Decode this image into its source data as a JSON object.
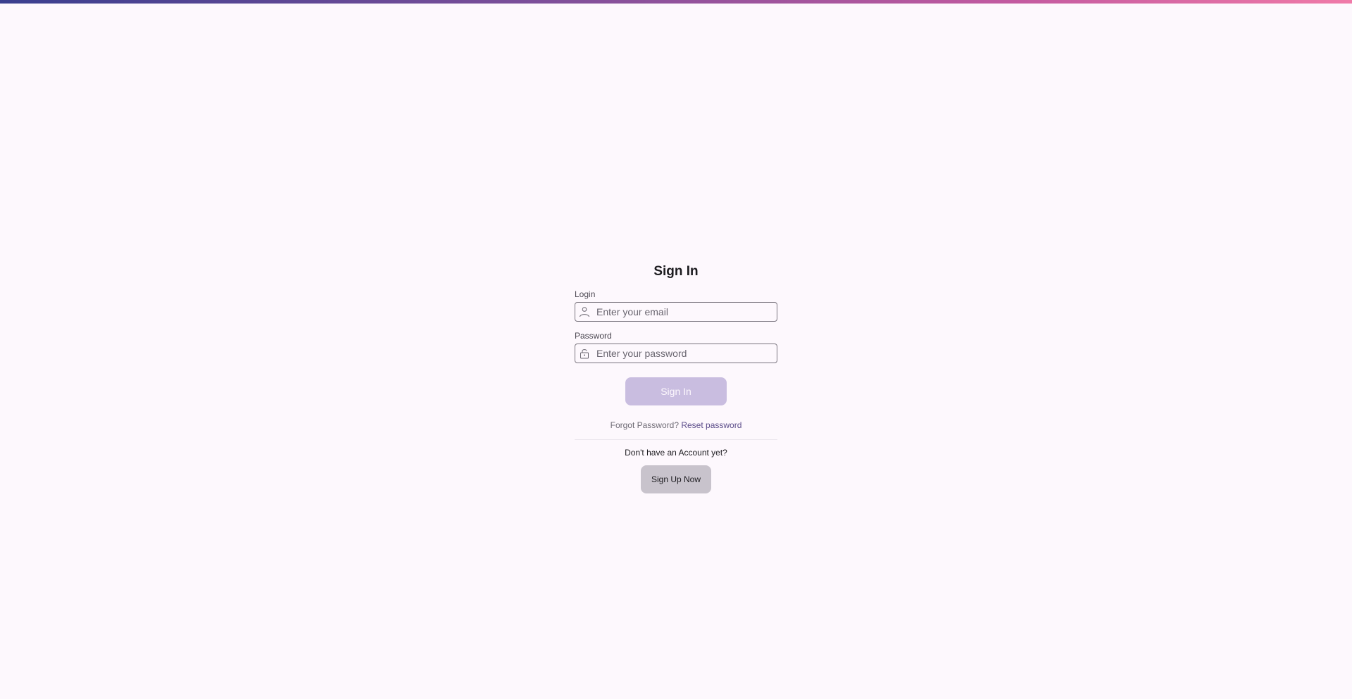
{
  "page": {
    "title": "Sign In"
  },
  "form": {
    "login_label": "Login",
    "login_placeholder": "Enter your email",
    "login_value": "",
    "login_icon": "user-icon",
    "password_label": "Password",
    "password_placeholder": "Enter your password",
    "password_value": "",
    "password_icon": "lock-icon",
    "submit_label": "Sign In"
  },
  "forgot": {
    "prompt": "Forgot Password?",
    "link_label": "Reset password"
  },
  "signup": {
    "prompt": "Don't have an Account yet?",
    "button_label": "Sign Up Now"
  },
  "colors": {
    "background": "#fdf8fd",
    "primary_disabled": "#c9bde0",
    "link": "#5c4d8a",
    "secondary_button": "#c8c3cc"
  }
}
